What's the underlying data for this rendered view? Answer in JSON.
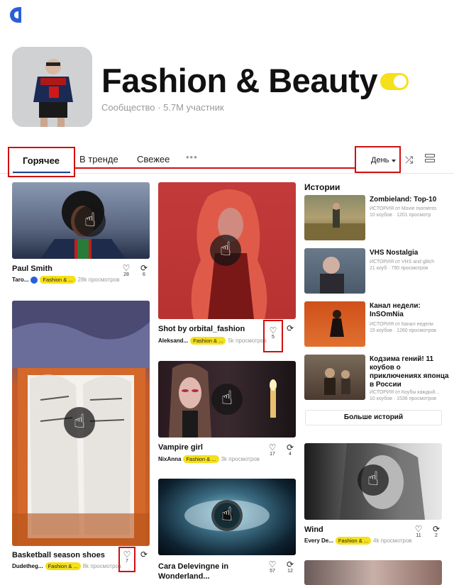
{
  "community": {
    "title": "Fashion & Beauty",
    "subtitle": "Сообщество · 5.7M участник"
  },
  "tabs": {
    "hot": "Горячее",
    "trending": "В тренде",
    "fresh": "Свежее",
    "more": "•••"
  },
  "sort": {
    "label": "День"
  },
  "cards": [
    {
      "title": "Paul Smith",
      "author": "Taro...",
      "tag": "Fashion & ...",
      "views": "28k просмотров",
      "likes": "28",
      "recubes": "6"
    },
    {
      "title": "Basketball season shoes",
      "author": "Dudetheg...",
      "tag": "Fashion & ...",
      "views": "8k просмотров",
      "likes": "7",
      "recubes": ""
    },
    {
      "title": "Shot by orbital_fashion",
      "author": "Aleksand...",
      "tag": "Fashion & ...",
      "views": "5k просмотров",
      "likes": "5",
      "recubes": ""
    },
    {
      "title": "Vampire girl",
      "author": "NixAnna",
      "tag": "Fashion & ...",
      "views": "3k просмотров",
      "likes": "17",
      "recubes": "4"
    },
    {
      "title": "Cara Delevingne in Wonderland...",
      "author": "",
      "tag": "",
      "views": "",
      "likes": "57",
      "recubes": "12"
    },
    {
      "title": "Wind",
      "author": "Every De...",
      "tag": "Fashion & ...",
      "views": "4k просмотров",
      "likes": "11",
      "recubes": "2"
    }
  ],
  "stories": {
    "heading": "Истории",
    "items": [
      {
        "title": "Zombieland: Top-10",
        "meta1": "ИСТОРИЯ от Movie moments",
        "meta2": "10 коубов · 1201 просмотр"
      },
      {
        "title": "VHS Nostalgia",
        "meta1": "ИСТОРИЯ от VHS and glitch",
        "meta2": "21 коуб · 790 просмотров"
      },
      {
        "title": "Канал недели: InSOmNia",
        "meta1": "ИСТОРИЯ от Канал недели",
        "meta2": "15 коубов · 1260 просмотров"
      },
      {
        "title": "Кодзима гений! 11 коубов о приключениях японца в России",
        "meta1": "ИСТОРИЯ от Коубы каждый...",
        "meta2": "10 коубов · 1536 просмотров"
      }
    ],
    "more_button": "Больше историй"
  }
}
